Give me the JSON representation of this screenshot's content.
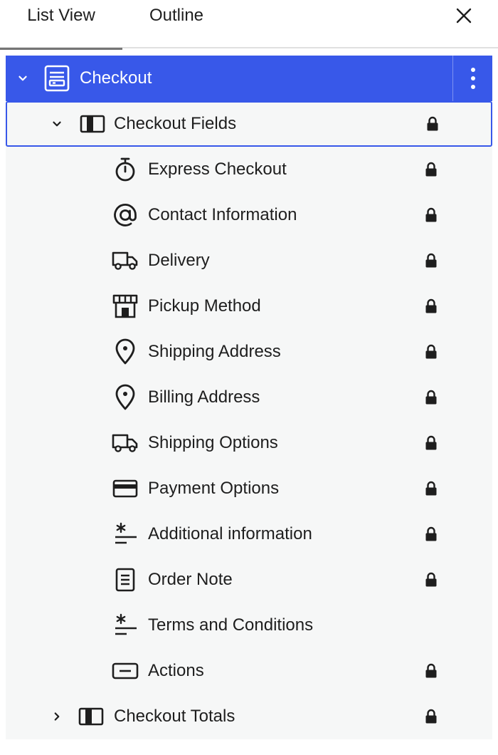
{
  "tabs": {
    "list_view": "List View",
    "outline": "Outline"
  },
  "colors": {
    "accent": "#3858e9",
    "tree_background": "#f6f7f7",
    "text": "#1e1e1e"
  },
  "tree": {
    "root": {
      "label": "Checkout",
      "icon": "checkout-form-icon",
      "expanded": true,
      "selected": true
    },
    "checkout_fields": {
      "label": "Checkout Fields",
      "icon": "columns-block-icon",
      "expanded": true,
      "locked": true
    },
    "children": [
      {
        "label": "Express Checkout",
        "icon": "stopwatch-icon",
        "locked": true
      },
      {
        "label": "Contact Information",
        "icon": "at-sign-icon",
        "locked": true
      },
      {
        "label": "Delivery",
        "icon": "truck-icon",
        "locked": true
      },
      {
        "label": "Pickup Method",
        "icon": "store-icon",
        "locked": true
      },
      {
        "label": "Shipping Address",
        "icon": "map-pin-icon",
        "locked": true
      },
      {
        "label": "Billing Address",
        "icon": "map-pin-icon",
        "locked": true
      },
      {
        "label": "Shipping Options",
        "icon": "truck-icon",
        "locked": true
      },
      {
        "label": "Payment Options",
        "icon": "credit-card-icon",
        "locked": true
      },
      {
        "label": "Additional information",
        "icon": "asterisk-lines-icon",
        "locked": true
      },
      {
        "label": "Order Note",
        "icon": "document-icon",
        "locked": true
      },
      {
        "label": "Terms and Conditions",
        "icon": "asterisk-lines-icon",
        "locked": false
      },
      {
        "label": "Actions",
        "icon": "button-icon",
        "locked": true
      }
    ],
    "checkout_totals": {
      "label": "Checkout Totals",
      "icon": "columns-block-icon",
      "expanded": false,
      "locked": true
    }
  }
}
